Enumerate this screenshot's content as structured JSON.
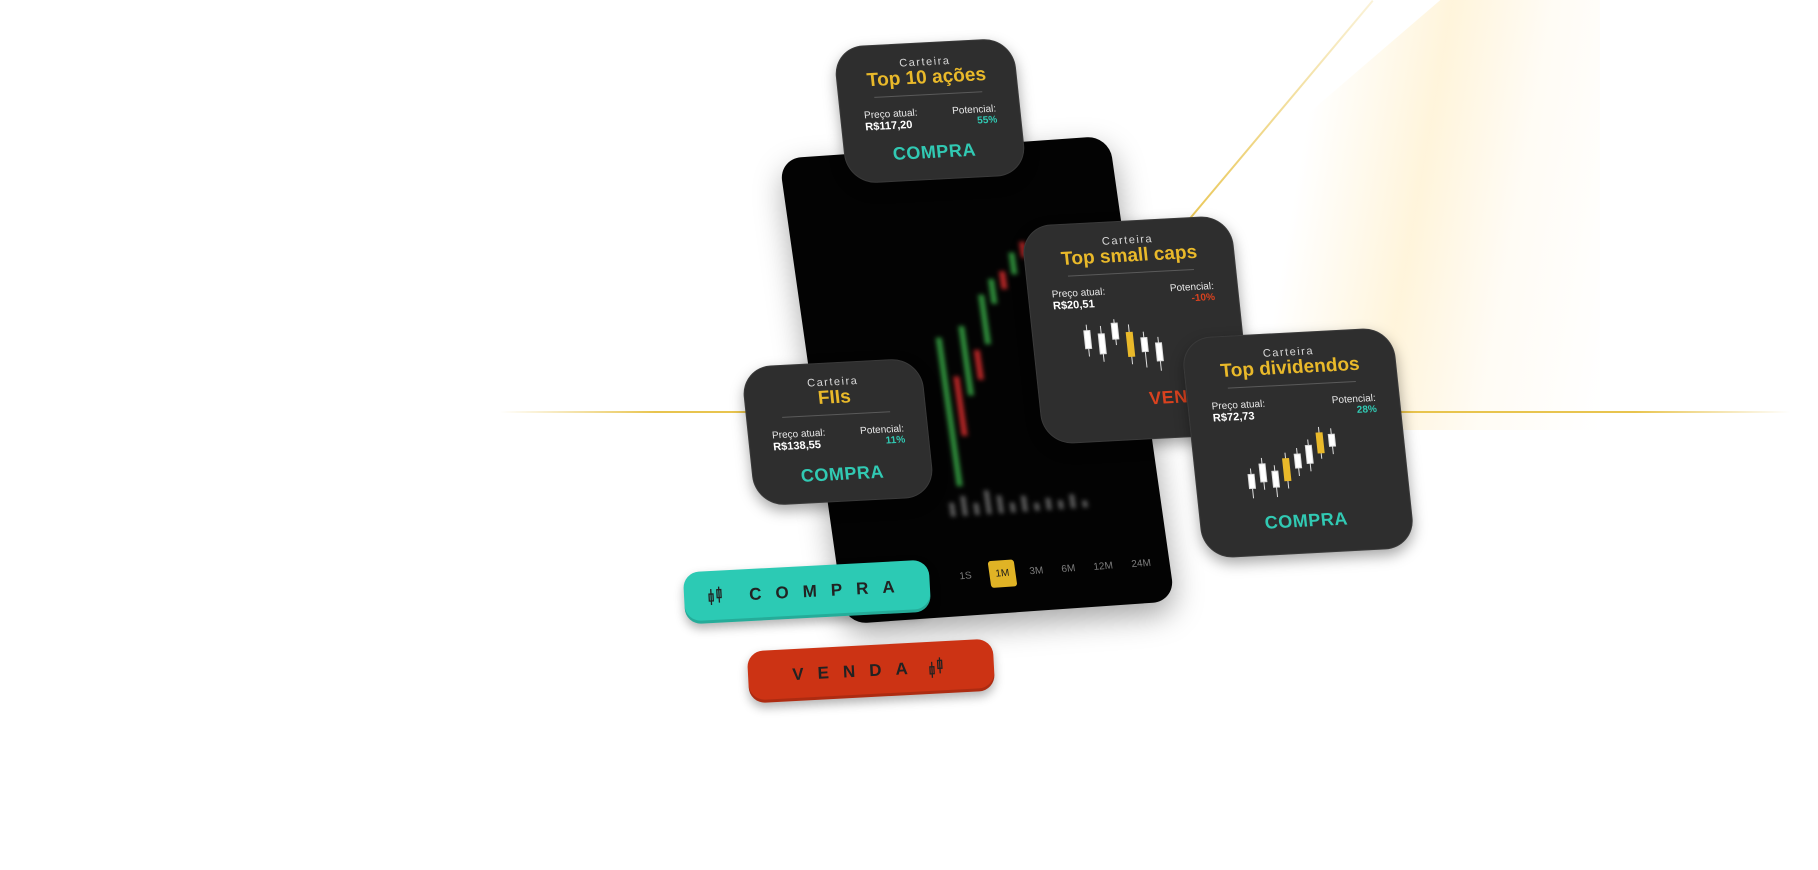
{
  "cards": {
    "top10": {
      "kicker": "Carteira",
      "title": "Top 10 ações",
      "price_label": "Preço atual:",
      "price": "R$117,20",
      "potential_label": "Potencial:",
      "potential": "55%",
      "action": "COMPRA"
    },
    "smallcaps": {
      "kicker": "Carteira",
      "title": "Top small caps",
      "price_label": "Preço atual:",
      "price": "R$20,51",
      "potential_label": "Potencial:",
      "potential": "-10%",
      "action": "VENDA"
    },
    "fiis": {
      "kicker": "Carteira",
      "title": "FIIs",
      "price_label": "Preço atual:",
      "price": "R$138,55",
      "potential_label": "Potencial:",
      "potential": "11%",
      "action": "COMPRA"
    },
    "dividendos": {
      "kicker": "Carteira",
      "title": "Top dividendos",
      "price_label": "Preço atual:",
      "price": "R$72,73",
      "potential_label": "Potencial:",
      "potential": "28%",
      "action": "COMPRA"
    }
  },
  "pills": {
    "buy": "COMPRA",
    "sell": "VENDA"
  },
  "phone": {
    "tabs": [
      "1S",
      "1M",
      "3M",
      "6M",
      "12M",
      "24M"
    ],
    "active_tab": "1M"
  },
  "colors": {
    "teal": "#31c9b3",
    "red": "#d9421f",
    "gold": "#e9b92a",
    "card": "#2e2e2e"
  },
  "icons": [
    "candlestick-icon"
  ]
}
